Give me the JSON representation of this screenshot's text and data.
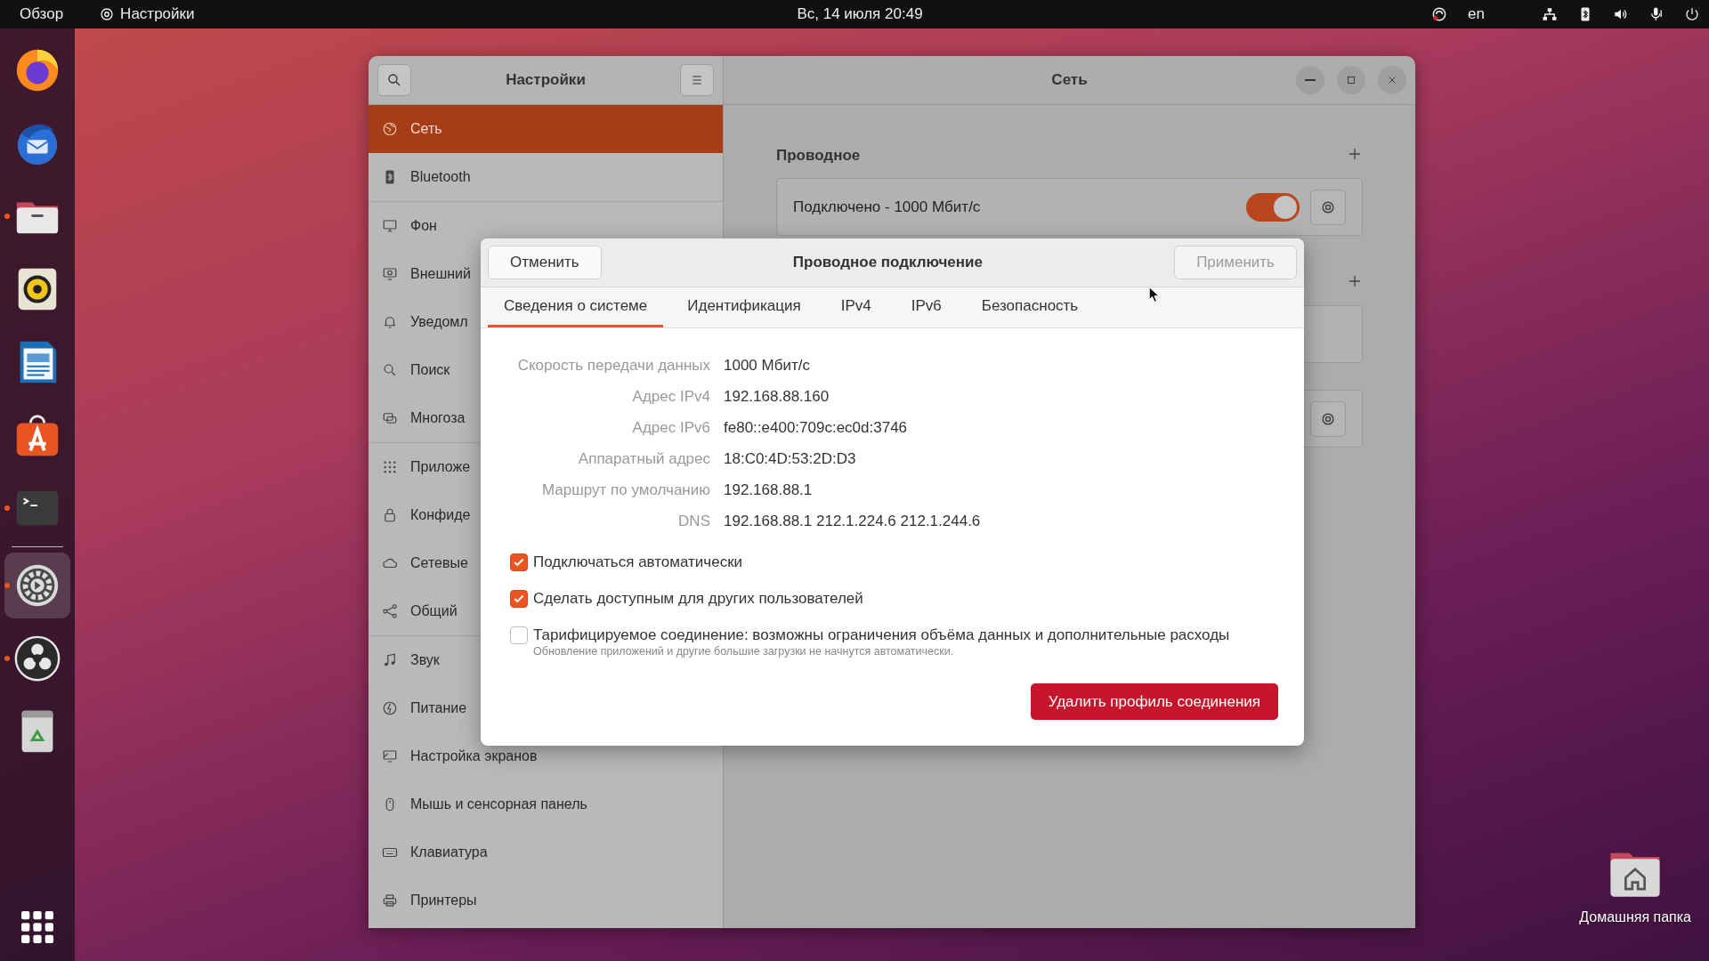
{
  "top_bar": {
    "activities": "Обзор",
    "app_menu": "Настройки",
    "clock": "Вс, 14 июля  20:49",
    "keyboard_layout": "en"
  },
  "dock": {
    "apps": [
      {
        "kind": "browser",
        "running": false,
        "selected": false
      },
      {
        "kind": "mail",
        "running": false,
        "selected": false
      },
      {
        "kind": "files",
        "running": true,
        "selected": false
      },
      {
        "kind": "music",
        "running": false,
        "selected": false
      },
      {
        "kind": "writer",
        "running": false,
        "selected": false
      },
      {
        "kind": "store",
        "running": false,
        "selected": false
      },
      {
        "kind": "terminal",
        "running": true,
        "selected": false
      },
      {
        "kind": "settings",
        "running": true,
        "selected": true
      },
      {
        "kind": "obs",
        "running": true,
        "selected": false
      },
      {
        "kind": "trash",
        "running": false,
        "selected": false
      }
    ]
  },
  "settings_window": {
    "sidebar_title": "Настройки",
    "title": "Сеть",
    "sidebar": {
      "groups": [
        {
          "items": [
            {
              "kind": "network",
              "label": "Сеть",
              "selected": true
            },
            {
              "kind": "bluetooth",
              "label": "Bluetooth",
              "selected": false
            }
          ]
        },
        {
          "items": [
            {
              "kind": "background",
              "label": "Фон",
              "selected": false
            },
            {
              "kind": "appearance",
              "label": "Внешний",
              "selected": false
            },
            {
              "kind": "notifications",
              "label": "Уведомл",
              "selected": false
            },
            {
              "kind": "search",
              "label": "Поиск",
              "selected": false
            },
            {
              "kind": "multitasking",
              "label": "Многоза",
              "selected": false
            }
          ]
        },
        {
          "items": [
            {
              "kind": "apps",
              "label": "Приложе",
              "selected": false
            },
            {
              "kind": "privacy",
              "label": "Конфиде",
              "selected": false
            },
            {
              "kind": "online",
              "label": "Сетевые",
              "selected": false
            },
            {
              "kind": "sharing",
              "label": "Общий",
              "selected": false
            }
          ]
        },
        {
          "items": [
            {
              "kind": "sound",
              "label": "Звук",
              "selected": false
            },
            {
              "kind": "power",
              "label": "Питание",
              "selected": false
            },
            {
              "kind": "displays",
              "label": "Настройка экранов",
              "selected": false
            },
            {
              "kind": "mouse",
              "label": "Мышь и сенсорная панель",
              "selected": false
            },
            {
              "kind": "keyboard",
              "label": "Клавиатура",
              "selected": false
            },
            {
              "kind": "printers",
              "label": "Принтеры",
              "selected": false
            }
          ]
        }
      ]
    },
    "wired": {
      "title": "Проводное",
      "connection": {
        "status": "Подключено - 1000 Мбит/с",
        "on": true
      }
    }
  },
  "dialog": {
    "cancel": "Отменить",
    "title": "Проводное подключение",
    "apply": {
      "label": "Применить",
      "disabled": true
    },
    "tabs": [
      {
        "label": "Сведения о системе",
        "selected": true
      },
      {
        "label": "Идентификация",
        "selected": false
      },
      {
        "label": "IPv4",
        "selected": false
      },
      {
        "label": "IPv6",
        "selected": false
      },
      {
        "label": "Безопасность",
        "selected": false
      }
    ],
    "details": [
      {
        "label": "Скорость передачи данных",
        "value": "1000 Мбит/с"
      },
      {
        "label": "Адрес IPv4",
        "value": "192.168.88.160"
      },
      {
        "label": "Адрес IPv6",
        "value": "fe80::e400:709c:ec0d:3746"
      },
      {
        "label": "Аппаратный адрес",
        "value": "18:C0:4D:53:2D:D3"
      },
      {
        "label": "Маршрут по умолчанию",
        "value": "192.168.88.1"
      },
      {
        "label": "DNS",
        "value": "192.168.88.1 212.1.224.6 212.1.244.6"
      }
    ],
    "options": [
      {
        "label": "Подключаться автоматически",
        "checked": true
      },
      {
        "label": "Сделать доступным для других пользователей",
        "checked": true
      },
      {
        "label": "Тарифицируемое соединение: возможны ограничения объёма данных и дополнительные расходы",
        "hint": "Обновление приложений и другие большие загрузки не начнутся автоматически.",
        "checked": false
      }
    ],
    "delete_button": "Удалить профиль соединения"
  },
  "desktop": {
    "home_folder": "Домашняя папка"
  }
}
